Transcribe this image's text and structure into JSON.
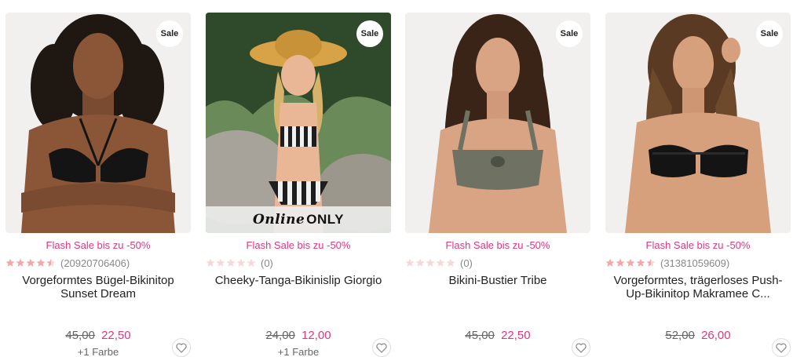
{
  "colors": {
    "sale_pink": "#e2357f",
    "star_filled": "#f4a7a7",
    "star_empty": "#f6d8d8"
  },
  "products": [
    {
      "badge": "Sale",
      "flash": "Flash Sale bis zu -50%",
      "stars": 4.5,
      "rating_count": "(20920706406)",
      "title": "Vorgeformtes Bügel-Bikinitop Sunset Dream",
      "old_price": "45,00",
      "new_price": "22,50",
      "colors_text": "+1 Farbe",
      "icon": "heart-icon"
    },
    {
      "badge": "Sale",
      "online_script": "Online",
      "online_only": "ONLY",
      "flash": "Flash Sale bis zu -50%",
      "stars": 0,
      "rating_count": "(0)",
      "title": "Cheeky-Tanga-Bikinislip Giorgio",
      "old_price": "24,00",
      "new_price": "12,00",
      "colors_text": "+1 Farbe",
      "icon": "heart-icon"
    },
    {
      "badge": "Sale",
      "flash": "Flash Sale bis zu -50%",
      "stars": 0,
      "rating_count": "(0)",
      "title": "Bikini-Bustier Tribe",
      "old_price": "45,00",
      "new_price": "22,50",
      "icon": "heart-icon"
    },
    {
      "badge": "Sale",
      "flash": "Flash Sale bis zu -50%",
      "stars": 4.5,
      "rating_count": "(31381059609)",
      "title": "Vorgeformtes, trägerloses Push-Up-Bikinitop Makramee C...",
      "old_price": "52,00",
      "new_price": "26,00",
      "icon": "heart-icon"
    }
  ]
}
